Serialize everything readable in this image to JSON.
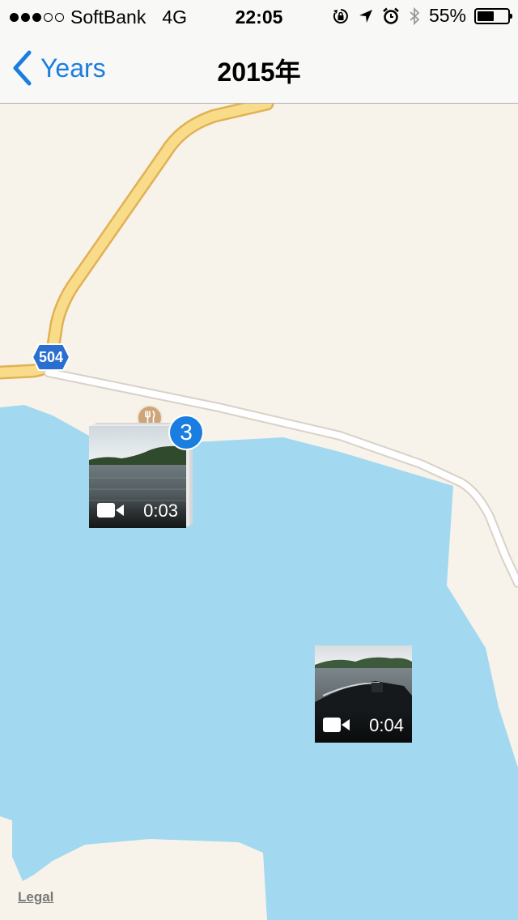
{
  "status": {
    "carrier": "SoftBank",
    "network": "4G",
    "time": "22:05",
    "battery": "55%",
    "battery_level": 0.55,
    "signal_strength": 3,
    "signal_max": 5,
    "icons": [
      "orientation-lock-icon",
      "location-arrow-icon",
      "alarm-icon",
      "bluetooth-icon"
    ]
  },
  "nav": {
    "back_label": "Years",
    "title": "2015年"
  },
  "map": {
    "route_number": "504",
    "poi_icon": "restaurant-icon",
    "legal_label": "Legal",
    "colors": {
      "land": "#f7f3ea",
      "water": "#a3d9f0",
      "highway": "#f8dc8a",
      "highway_edge": "#e1b154",
      "road": "#ffffff",
      "road_edge": "#d8d2c6",
      "shield": "#2a6fd0"
    }
  },
  "photos": [
    {
      "name": "photo-cluster-lake",
      "duration": "0:03",
      "count": "3",
      "media_icon": "video-camera-icon"
    },
    {
      "name": "photo-boat",
      "duration": "0:04",
      "media_icon": "video-camera-icon"
    }
  ],
  "accent_color": "#1a7ee0"
}
